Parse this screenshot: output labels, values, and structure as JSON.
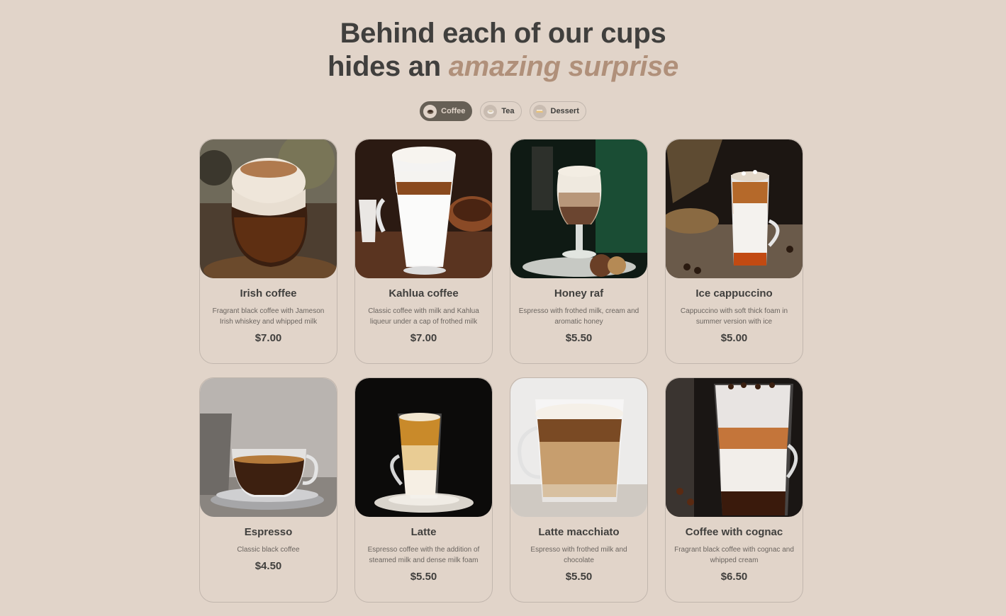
{
  "heading": {
    "line1": "Behind each of our cups",
    "line2_prefix": "hides an",
    "line2_accent": "amazing surprise"
  },
  "tabs": [
    {
      "label": "Coffee",
      "icon": "coffee-cup-icon",
      "active": true
    },
    {
      "label": "Tea",
      "icon": "tea-cup-icon",
      "active": false
    },
    {
      "label": "Dessert",
      "icon": "dessert-icon",
      "active": false
    }
  ],
  "products": [
    {
      "name": "Irish coffee",
      "description": "Fragrant black coffee with Jameson Irish whiskey and whipped milk",
      "price": "$7.00",
      "image": "irish-coffee-photo"
    },
    {
      "name": "Kahlua coffee",
      "description": "Classic coffee with milk and Kahlua liqueur under a cap of frothed milk",
      "price": "$7.00",
      "image": "kahlua-coffee-photo"
    },
    {
      "name": "Honey raf",
      "description": "Espresso with frothed milk, cream and aromatic honey",
      "price": "$5.50",
      "image": "honey-raf-photo"
    },
    {
      "name": "Ice cappuccino",
      "description": "Cappuccino with soft thick foam in summer version with ice",
      "price": "$5.00",
      "image": "ice-cappuccino-photo"
    },
    {
      "name": "Espresso",
      "description": "Classic black coffee",
      "price": "$4.50",
      "image": "espresso-photo"
    },
    {
      "name": "Latte",
      "description": "Espresso coffee with the addition of steamed milk and dense milk foam",
      "price": "$5.50",
      "image": "latte-photo"
    },
    {
      "name": "Latte macchiato",
      "description": "Espresso with frothed milk and chocolate",
      "price": "$5.50",
      "image": "latte-macchiato-photo"
    },
    {
      "name": "Coffee with cognac",
      "description": "Fragrant black coffee with cognac and whipped cream",
      "price": "$6.50",
      "image": "coffee-with-cognac-photo"
    }
  ]
}
